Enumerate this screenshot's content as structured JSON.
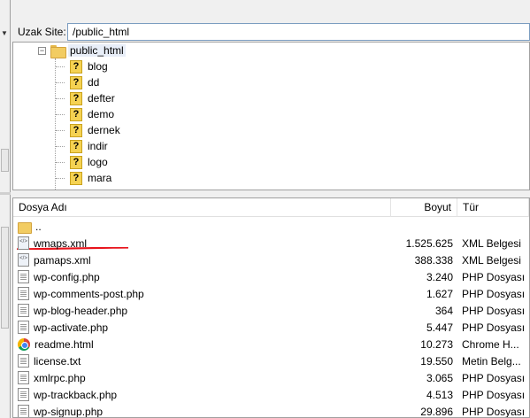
{
  "remote_site": {
    "label": "Uzak Site:",
    "path": "/public_html"
  },
  "tree": {
    "root": "public_html",
    "children": [
      "blog",
      "dd",
      "defter",
      "demo",
      "dernek",
      "indir",
      "logo",
      "mara"
    ]
  },
  "filelist": {
    "columns": {
      "name": "Dosya Adı",
      "size": "Boyut",
      "type": "Tür"
    },
    "rows": [
      {
        "name": "..",
        "size": "",
        "type": "",
        "icon": "folder-up-icon"
      },
      {
        "name": "wmaps.xml",
        "size": "1.525.625",
        "type": "XML Belgesi",
        "icon": "xml-file-icon"
      },
      {
        "name": "pamaps.xml",
        "size": "388.338",
        "type": "XML Belgesi",
        "icon": "xml-file-icon"
      },
      {
        "name": "wp-config.php",
        "size": "3.240",
        "type": "PHP Dosyası",
        "icon": "php-file-icon"
      },
      {
        "name": "wp-comments-post.php",
        "size": "1.627",
        "type": "PHP Dosyası",
        "icon": "php-file-icon"
      },
      {
        "name": "wp-blog-header.php",
        "size": "364",
        "type": "PHP Dosyası",
        "icon": "php-file-icon"
      },
      {
        "name": "wp-activate.php",
        "size": "5.447",
        "type": "PHP Dosyası",
        "icon": "php-file-icon"
      },
      {
        "name": "readme.html",
        "size": "10.273",
        "type": "Chrome H...",
        "icon": "chrome-html-icon"
      },
      {
        "name": "license.txt",
        "size": "19.550",
        "type": "Metin Belg...",
        "icon": "text-file-icon"
      },
      {
        "name": "xmlrpc.php",
        "size": "3.065",
        "type": "PHP Dosyası",
        "icon": "php-file-icon"
      },
      {
        "name": "wp-trackback.php",
        "size": "4.513",
        "type": "PHP Dosyası",
        "icon": "php-file-icon"
      },
      {
        "name": "wp-signup.php",
        "size": "29.896",
        "type": "PHP Dosyası",
        "icon": "php-file-icon"
      }
    ]
  },
  "colors": {
    "annotation_red": "#e8141c",
    "selection_bg": "#e8eef8",
    "folder": "#f2cc62",
    "unknown_folder": "#f5d252"
  }
}
